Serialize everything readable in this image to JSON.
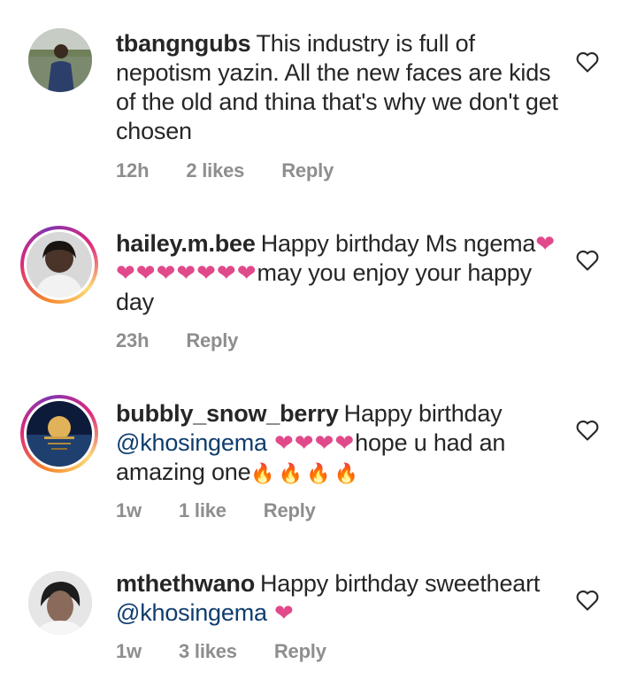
{
  "comments": [
    {
      "username": "tbangngubs",
      "parts": [
        {
          "t": "This industry is full of nepotism yazin. All the new faces are kids of the old and thina that's why we don't get chosen"
        }
      ],
      "time": "12h",
      "likes": "2 likes",
      "reply": "Reply"
    },
    {
      "username": "hailey.m.bee",
      "parts": [
        {
          "t": "Happy birthday Ms ngema"
        },
        {
          "t": "❤❤❤❤❤❤❤❤",
          "kind": "heart"
        },
        {
          "t": "may you enjoy your happy day"
        }
      ],
      "time": "23h",
      "likes": "",
      "reply": "Reply"
    },
    {
      "username": "bubbly_snow_berry",
      "parts": [
        {
          "t": "Happy birthday "
        },
        {
          "t": "@khosingema",
          "kind": "mention"
        },
        {
          "t": " ❤❤❤❤",
          "kind": "heart"
        },
        {
          "t": "hope u had an amazing one"
        },
        {
          "t": "🔥🔥🔥🔥",
          "kind": "fire"
        }
      ],
      "time": "1w",
      "likes": "1 like",
      "reply": "Reply"
    },
    {
      "username": "mthethwano",
      "parts": [
        {
          "t": "Happy birthday sweetheart "
        },
        {
          "t": "@khosingema",
          "kind": "mention"
        },
        {
          "t": " ❤",
          "kind": "heart"
        }
      ],
      "time": "1w",
      "likes": "3 likes",
      "reply": "Reply"
    }
  ],
  "icons": {
    "like": "heart-outline-icon"
  },
  "colors": {
    "mention": "#0f3d6e",
    "heart": "#e04a8a",
    "meta": "#8e8e8e"
  }
}
